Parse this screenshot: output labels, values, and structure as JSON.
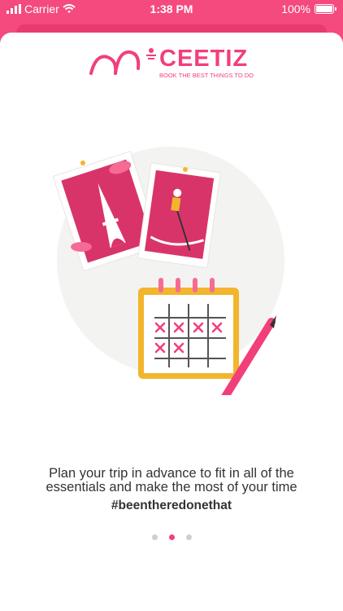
{
  "status": {
    "carrier": "Carrier",
    "time": "1:38 PM",
    "battery": "100%"
  },
  "logo": {
    "brand": "CEETIZ",
    "tagline": "BOOK THE BEST THINGS TO DO"
  },
  "onboarding": {
    "line1": "Plan your trip in advance to fit in all of the",
    "line2": "essentials and make the most of your time",
    "hashtag": "#beentheredonethat",
    "page_dots": [
      {
        "active": false
      },
      {
        "active": true
      },
      {
        "active": false
      }
    ]
  },
  "colors": {
    "accent": "#f23f79",
    "status_bar_bg": "#f44a7e",
    "calendar_frame": "#f3b52d"
  }
}
